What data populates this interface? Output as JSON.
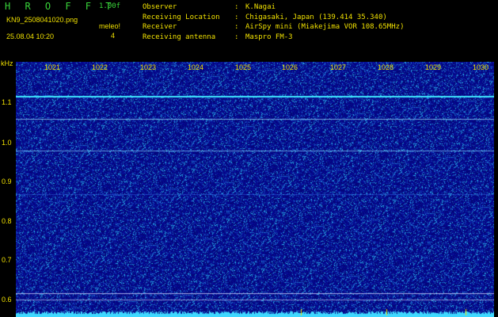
{
  "header": {
    "app_title": "H R O F F T",
    "version": "1.00f",
    "filename": "KN9_2508041020.png",
    "meteor_label": "meleo!",
    "meteor_count": "4",
    "datetime": "25.08.04 10:20"
  },
  "meta": [
    {
      "key": "Observer",
      "sep": ":",
      "value": "K.Nagai"
    },
    {
      "key": "Receiving Location",
      "sep": ":",
      "value": "Chigasaki, Japan (139.414 35.340)"
    },
    {
      "key": "Receiver",
      "sep": ":",
      "value": "AirSpy mini (Miakejima VOR 108.65MHz)"
    },
    {
      "key": "Receiving antenna",
      "sep": ":",
      "value": "Maspro FM-3"
    }
  ],
  "y_unit": "kHz",
  "y_ticks": [
    "1.1",
    "1.0",
    "0.9",
    "0.8",
    "0.7",
    "0.6"
  ],
  "x_ticks": [
    "1021",
    "1022",
    "1023",
    "1024",
    "1025",
    "1026",
    "1027",
    "1028",
    "1029",
    "1030"
  ],
  "colors": {
    "label": "#f0e000",
    "title": "#39d43a",
    "background": "#05068a",
    "signal": "#3fe8ff"
  }
}
